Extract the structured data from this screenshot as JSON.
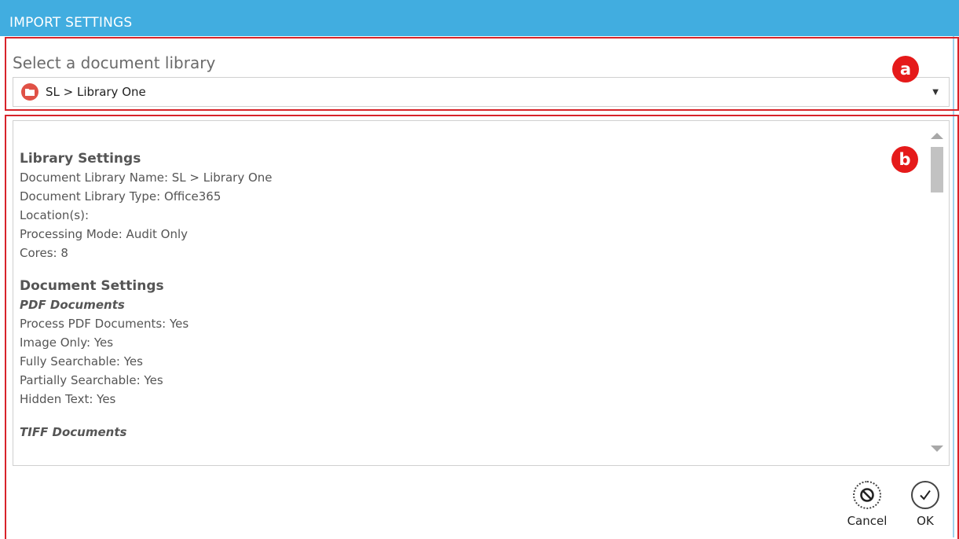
{
  "header": {
    "title": "IMPORT SETTINGS"
  },
  "library_select": {
    "label": "Select a document library",
    "value": "SL > Library One",
    "icon": "folder-icon"
  },
  "annotations": {
    "a": "a",
    "b": "b"
  },
  "settings": {
    "library_heading": "Library Settings",
    "library_lines": [
      "Document Library Name: SL > Library One",
      "Document Library Type: Office365",
      "Location(s):",
      "Processing Mode: Audit Only",
      "Cores: 8"
    ],
    "document_heading": "Document Settings",
    "pdf_subheading": "PDF Documents",
    "pdf_lines": [
      "Process PDF Documents: Yes",
      "Image Only: Yes",
      "Fully Searchable: Yes",
      "Partially Searchable: Yes",
      "Hidden Text: Yes"
    ],
    "tiff_subheading": "TIFF Documents"
  },
  "actions": {
    "cancel_label": "Cancel",
    "ok_label": "OK"
  },
  "colors": {
    "header": "#41ade0",
    "annotation": "#e51a1a",
    "folder_icon": "#e05146"
  }
}
